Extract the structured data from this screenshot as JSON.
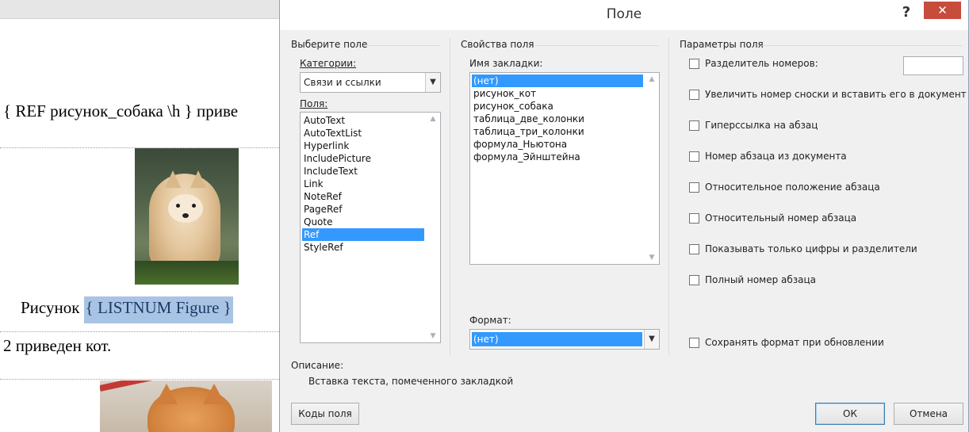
{
  "document": {
    "ref_line": "{ REF рисунок_собака \\h } приве",
    "caption_prefix": "Рисунок ",
    "caption_field": "{ LISTNUM  Figure }",
    "line2": "2 приведен кот."
  },
  "dialog": {
    "title": "Поле",
    "help_label": "?",
    "close_label": "✕",
    "choose_field": {
      "group_title": "Выберите поле",
      "categories_label": "Категории:",
      "category_value": "Связи и ссылки",
      "fields_label": "Поля:",
      "fields": [
        "AutoText",
        "AutoTextList",
        "Hyperlink",
        "IncludePicture",
        "IncludeText",
        "Link",
        "NoteRef",
        "PageRef",
        "Quote",
        "Ref",
        "StyleRef"
      ],
      "selected_field": "Ref"
    },
    "field_properties": {
      "group_title": "Свойства поля",
      "bookmark_label": "Имя закладки:",
      "bookmarks": [
        "(нет)",
        "рисунок_кот",
        "рисунок_собака",
        "таблица_две_колонки",
        "таблица_три_колонки",
        "формула_Ньютона",
        "формула_Эйнштейна"
      ],
      "selected_bookmark": "(нет)",
      "format_label": "Формат:",
      "format_value": "(нет)"
    },
    "field_options": {
      "group_title": "Параметры поля",
      "options": [
        {
          "label": "Разделитель номеров:",
          "checked": false
        },
        {
          "label": "Увеличить номер сноски и вставить его в документ",
          "checked": false
        },
        {
          "label": "Гиперссылка на абзац",
          "checked": false
        },
        {
          "label": "Номер абзаца из документа",
          "checked": false
        },
        {
          "label": "Относительное положение абзаца",
          "checked": false
        },
        {
          "label": "Относительный номер абзаца",
          "checked": false
        },
        {
          "label": "Показывать только цифры и разделители",
          "checked": false
        },
        {
          "label": "Полный номер абзаца",
          "checked": false
        }
      ],
      "preserve_format": {
        "label": "Сохранять формат при обновлении",
        "checked": false
      },
      "separator_value": ""
    },
    "description": {
      "label": "Описание:",
      "text": "Вставка текста, помеченного закладкой"
    },
    "buttons": {
      "field_codes": "Коды поля",
      "ok": "ОК",
      "cancel": "Отмена"
    }
  }
}
